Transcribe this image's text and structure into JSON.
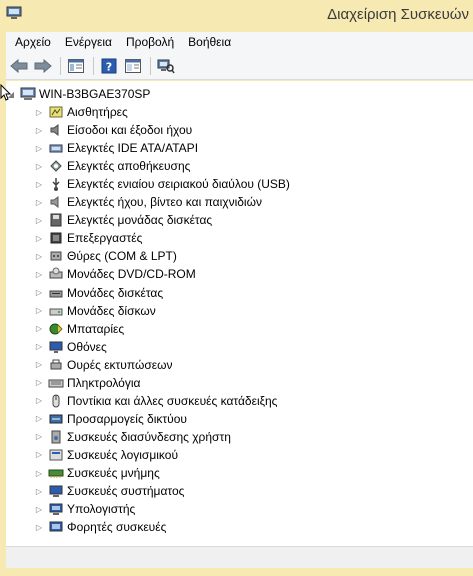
{
  "window": {
    "title": "Διαχείριση Συσκευών"
  },
  "menu": [
    {
      "label": "Αρχείο"
    },
    {
      "label": "Ενέργεια"
    },
    {
      "label": "Προβολή"
    },
    {
      "label": "Βοήθεια"
    }
  ],
  "toolbar": {
    "buttons": [
      "back-arrow-icon",
      "forward-arrow-icon",
      "show-hide-console-tree-icon",
      "help-icon",
      "properties-icon",
      "scan-hardware-icon"
    ]
  },
  "tree": {
    "root": {
      "label": "WIN-B3BGAE370SP",
      "icon": "computer-icon",
      "expanded": true
    },
    "items": [
      {
        "label": "Αισθητήρες",
        "icon": "sensor-icon"
      },
      {
        "label": "Είσοδοι και έξοδοι ήχου",
        "icon": "speaker-icon"
      },
      {
        "label": "Ελεγκτές IDE ATA/ATAPI",
        "icon": "ide-controller-icon"
      },
      {
        "label": "Ελεγκτές αποθήκευσης",
        "icon": "storage-controller-icon"
      },
      {
        "label": "Ελεγκτές ενιαίου σειριακού διαύλου (USB)",
        "icon": "usb-icon"
      },
      {
        "label": "Ελεγκτές ήχου, βίντεο και παιχνιδιών",
        "icon": "sound-video-icon"
      },
      {
        "label": "Ελεγκτές μονάδας δισκέτας",
        "icon": "floppy-controller-icon"
      },
      {
        "label": "Επεξεργαστές",
        "icon": "processor-icon"
      },
      {
        "label": "Θύρες (COM & LPT)",
        "icon": "port-icon"
      },
      {
        "label": "Μονάδες DVD/CD-ROM",
        "icon": "dvd-drive-icon"
      },
      {
        "label": "Μονάδες δισκέτας",
        "icon": "floppy-drive-icon"
      },
      {
        "label": "Μονάδες δίσκων",
        "icon": "disk-drive-icon"
      },
      {
        "label": "Μπαταρίες",
        "icon": "battery-icon"
      },
      {
        "label": "Οθόνες",
        "icon": "monitor-icon"
      },
      {
        "label": "Ουρές εκτυπώσεων",
        "icon": "print-queue-icon"
      },
      {
        "label": "Πληκτρολόγια",
        "icon": "keyboard-icon"
      },
      {
        "label": "Ποντίκια και άλλες συσκευές κατάδειξης",
        "icon": "mouse-icon"
      },
      {
        "label": "Προσαρμογείς δικτύου",
        "icon": "network-adapter-icon"
      },
      {
        "label": "Συσκευές διασύνδεσης χρήστη",
        "icon": "hid-icon"
      },
      {
        "label": "Συσκευές λογισμικού",
        "icon": "software-device-icon"
      },
      {
        "label": "Συσκευές μνήμης",
        "icon": "memory-icon"
      },
      {
        "label": "Συσκευές συστήματος",
        "icon": "system-device-icon"
      },
      {
        "label": "Υπολογιστής",
        "icon": "computer-icon"
      },
      {
        "label": "Φορητές συσκευές",
        "icon": "portable-device-icon"
      }
    ]
  }
}
